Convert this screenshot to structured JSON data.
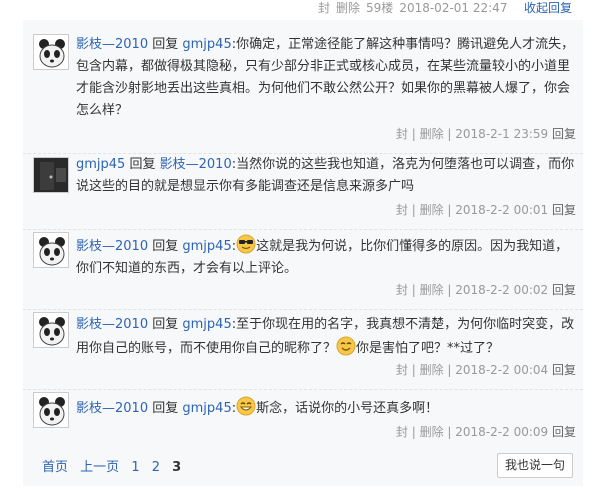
{
  "topbar": {
    "block": "封",
    "delete": "删除",
    "floor": "59楼",
    "timestamp": "2018-02-01 22:47",
    "collapse": "收起回复"
  },
  "replies": [
    {
      "avatar_icon": "panda-avatar-icon",
      "user": "影枝—2010",
      "verb": "回复",
      "target": "gmjp45",
      "text_before": ":你确定，正常途径能了解这种事情吗？腾讯避免人才流失，包含内幕，都做得极其隐秘，只有少部分非正式或核心成员，在某些流量较小的小道里才能含沙射影地丢出这些真相。为何他们不敢公然公开？如果你的黑幕被人爆了，你会怎么样？",
      "emoji_icon": "",
      "text_after": "",
      "emoji2_icon": "",
      "text_end": "",
      "block": "封",
      "delete": "删除",
      "time": "2018-2-1 23:59",
      "reply": "回复"
    },
    {
      "avatar_icon": "dark-room-avatar-icon",
      "user": "gmjp45",
      "verb": "回复",
      "target": "影枝—2010",
      "text_before": ":当然你说的这些我也知道，洛克为何堕落也可以调查，而你说这些的目的就是想显示你有多能调查还是信息来源多广吗",
      "emoji_icon": "",
      "text_after": "",
      "emoji2_icon": "",
      "text_end": "",
      "block": "封",
      "delete": "删除",
      "time": "2018-2-2 00:01",
      "reply": "回复"
    },
    {
      "avatar_icon": "panda-avatar-icon",
      "user": "影枝—2010",
      "verb": "回复",
      "target": "gmjp45",
      "text_before": ":",
      "emoji_icon": "sunglasses-emoji-icon",
      "text_after": "这就是我为何说，比你们懂得多的原因。因为我知道，你们不知道的东西，才会有以上评论。",
      "emoji2_icon": "",
      "text_end": "",
      "block": "封",
      "delete": "删除",
      "time": "2018-2-2 00:02",
      "reply": "回复"
    },
    {
      "avatar_icon": "panda-avatar-icon",
      "user": "影枝—2010",
      "verb": "回复",
      "target": "gmjp45",
      "text_before": ":至于你现在用的名字，我真想不清楚，为何你临时突变，改用你自己的账号，而不使用你自己的昵称了？",
      "emoji_icon": "smile-emoji-icon",
      "text_after": "你是害怕了吧？**过了？",
      "emoji2_icon": "",
      "text_end": "",
      "block": "封",
      "delete": "删除",
      "time": "2018-2-2 00:04",
      "reply": "回复"
    },
    {
      "avatar_icon": "panda-avatar-icon",
      "user": "影枝—2010",
      "verb": "回复",
      "target": "gmjp45",
      "text_before": ":",
      "emoji_icon": "grin-emoji-icon",
      "text_after": "斯念，话说你的小号还真多啊！",
      "emoji2_icon": "",
      "text_end": "",
      "block": "封",
      "delete": "删除",
      "time": "2018-2-2 00:09",
      "reply": "回复"
    }
  ],
  "pager": {
    "first": "首页",
    "prev": "上一页",
    "pages": [
      "1",
      "2",
      "3"
    ],
    "current": "3"
  },
  "say_button": "我也说一句"
}
